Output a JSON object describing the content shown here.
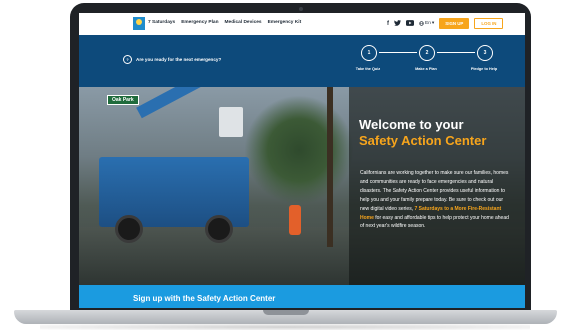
{
  "nav": {
    "links": [
      "7 Saturdays",
      "Emergency Plan",
      "Medical Devices",
      "Emergency Kit"
    ],
    "language": "En",
    "signup_label": "SIGN UP",
    "login_label": "LOG IN",
    "icons": [
      "facebook-icon",
      "twitter-icon",
      "youtube-icon",
      "globe-icon"
    ]
  },
  "steps": {
    "question": "Are you ready for the next emergency?",
    "items": [
      {
        "number": "1",
        "label": "Take the Quiz"
      },
      {
        "number": "2",
        "label": "Make a Plan"
      },
      {
        "number": "3",
        "label": "Pledge to Help"
      }
    ]
  },
  "hero": {
    "street_sign": "Oak Park",
    "title_line1": "Welcome to your",
    "title_line2": "Safety Action Center",
    "body_part1": "Californians are working together to make sure our families, homes and communities are ready to face emergencies and natural disasters. The Safety Action Center provides useful information to help you and your family prepare today. Be sure to check out our new digital video series, ",
    "body_link": "7 Saturdays to a More Fire-Resistant Home",
    "body_part2": " for easy and affordable tips to help protect your home ahead of next year's wildfire season."
  },
  "signup": {
    "text": "Sign up with the Safety Action Center"
  },
  "colors": {
    "accent": "#f7a51c",
    "nav_blue": "#0d4a7b",
    "signup_blue": "#1b9be0"
  }
}
